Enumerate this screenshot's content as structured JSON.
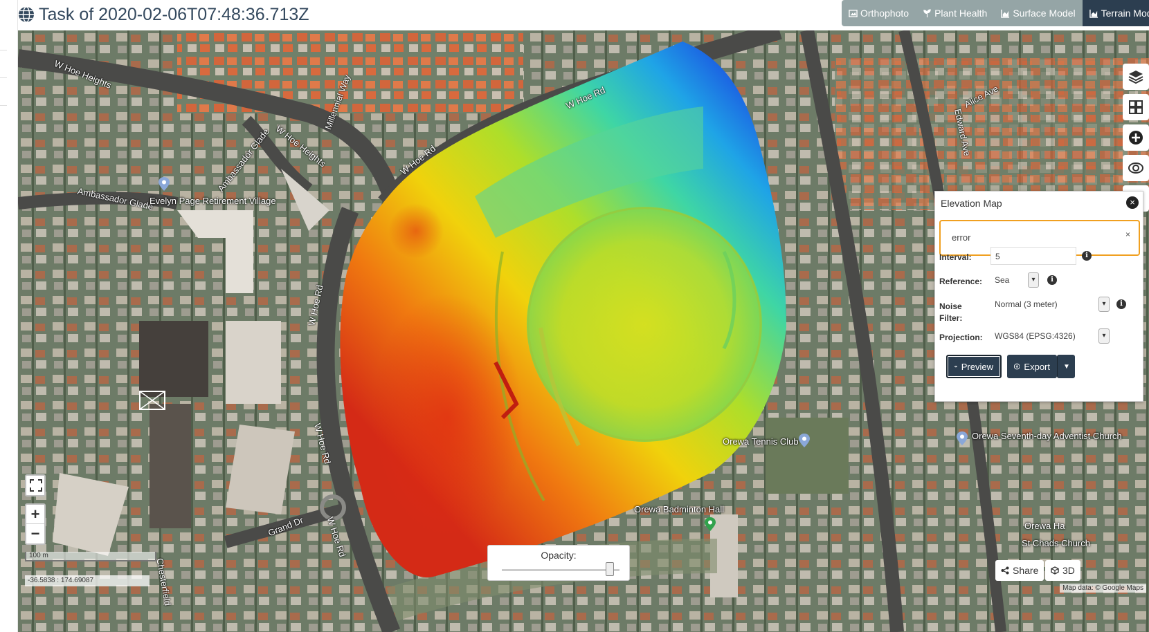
{
  "title": "Task of 2020-02-06T07:48:36.713Z",
  "view_tabs": [
    {
      "label": "Orthophoto",
      "icon": "image-icon"
    },
    {
      "label": "Plant Health",
      "icon": "plant-icon"
    },
    {
      "label": "Surface Model",
      "icon": "chart-area-icon"
    },
    {
      "label": "Terrain Model",
      "icon": "chart-area-icon",
      "active": true
    }
  ],
  "map": {
    "road_labels": [
      "W Hoe Heights",
      "W Hoe Heights",
      "Ambassador Glade",
      "Ambassador Glade",
      "Millennial Way",
      "W Hoe Rd",
      "W Hoe Rd",
      "W Hoe Rd",
      "W Hoe Rd",
      "W Hoe Rd",
      "Grand Dr",
      "Alice Ave",
      "Edward Ave",
      "Chesterfield"
    ],
    "poi_labels": {
      "retirement": "Evelyn Page Retirement Village",
      "tennis": "Orewa Tennis Club",
      "badminton": "Orewa Badminton Hall",
      "church": "Orewa Seventh-day Adventist Church",
      "chads": "St Chads Church",
      "orewa": "Orewa Ha"
    },
    "scale_label": "100 m",
    "coordinates": "-36.5838 : 174.69087",
    "attribution": "Map data: © Google Maps"
  },
  "elevation_panel": {
    "title": "Elevation Map",
    "error_text": "error",
    "interval_label": "Interval:",
    "interval_value": "5",
    "reference_label": "Reference:",
    "reference_value": "Sea",
    "noise_label": "Noise Filter:",
    "noise_value": "Normal (3 meter)",
    "projection_label": "Projection:",
    "projection_value": "WGS84 (EPSG:4326)",
    "preview_label": "Preview",
    "export_label": "Export"
  },
  "opacity": {
    "label": "Opacity:",
    "value": 0.95
  },
  "share_label": "Share",
  "threed_label": "3D",
  "zoom_in": "+",
  "zoom_out": "−",
  "close_symbol": "×"
}
